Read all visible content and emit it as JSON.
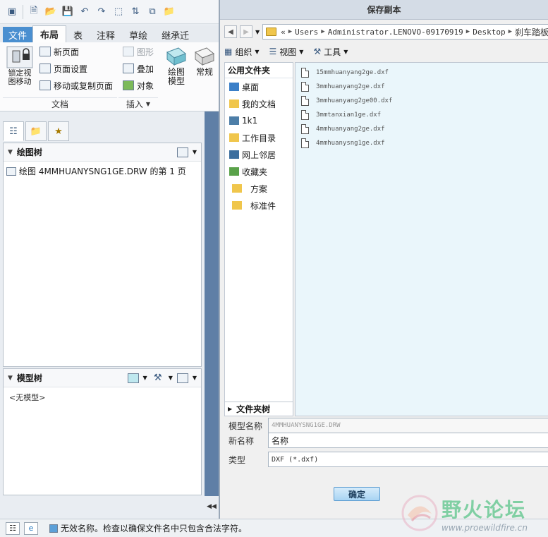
{
  "ribbon": {
    "tabs": [
      "文件",
      "布局",
      "表",
      "注释",
      "草绘",
      "继承迁"
    ],
    "active_tab": "布局",
    "lock_view_label": "锁定视图移动",
    "new_page": "新页面",
    "page_setup": "页面设置",
    "move_copy_page": "移动或复制页面",
    "graphics": "图形",
    "overlay": "叠加",
    "object": "对象",
    "draw_model": "绘图模型",
    "normal": "常规",
    "group_document": "文档",
    "group_insert": "插入"
  },
  "draw_tree": {
    "title": "绘图树",
    "node": "绘图 4MMHUANYSNG1GE.DRW 的第 1 页"
  },
  "model_tree": {
    "title": "模型树",
    "empty": "<无模型>"
  },
  "status": {
    "message": "无效名称。检查以确保文件名中只包含合法字符。"
  },
  "dialog": {
    "title": "保存副本",
    "breadcrumb": [
      "Users",
      "Administrator.LENOVO-09170919",
      "Desktop",
      "刹车踏板"
    ],
    "toolbar": {
      "organize": "组织",
      "view": "视图",
      "tools": "工具"
    },
    "sidebar": {
      "header": "公用文件夹",
      "items": [
        "桌面",
        "我的文档",
        "1k1",
        "工作目录",
        "网上邻居",
        "收藏夹",
        "方案",
        "标准件"
      ]
    },
    "files": [
      "15mmhuanyang2ge.dxf",
      "3mmhuanyang2ge.dxf",
      "3mmhuanyang2ge00.dxf",
      "3mmtanxian1ge.dxf",
      "4mmhuanyang2ge.dxf",
      "4mmhuanysng1ge.dxf"
    ],
    "folder_tree_label": "文件夹树",
    "model_name_label": "模型名称",
    "model_name_value": "4MMHUANYSNG1GE.DRW",
    "new_name_label": "新名称",
    "new_name_value": "名称",
    "type_label": "类型",
    "type_value": "DXF (*.dxf)",
    "ok_label": "确定"
  },
  "watermark": {
    "title": "野火论坛",
    "url": "www.proewildfire.cn"
  }
}
